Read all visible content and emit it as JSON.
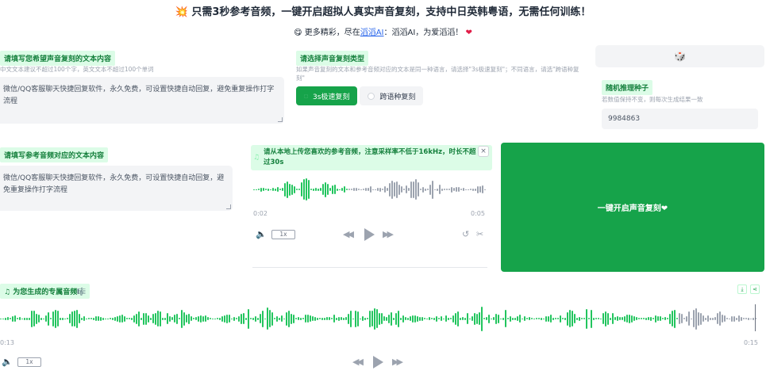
{
  "header": {
    "title": "💥 只需3秒参考音频，一键开启超拟人真实声音复刻，支持中日英韩粤语，无需任何训练！",
    "sub_prefix": "😋 更多精彩，尽在",
    "sub_link": "滔滔AI",
    "sub_suffix": "：滔滔AI，为爱滔滔！",
    "sub_heart": "❤"
  },
  "target_text": {
    "label": "请填写您希望声音复刻的文本内容",
    "hint": "中文文本建议不超过100个字，英文文本不超过100个单词",
    "value": "微信/QQ客服聊天快捷回复软件，永久免费，可设置快捷自动回复，避免重复操作打字流程"
  },
  "clone_type": {
    "label": "请选择声音复刻类型",
    "hint": "如果声音复刻的文本和参考音频对应的文本是同一种语言，请选择\"3s极速复刻\"；不同语言，请选\"跨语种复刻\"",
    "options": [
      "3s极速复刻",
      "跨语种复刻"
    ],
    "selected": "3s极速复刻"
  },
  "seed": {
    "dice_icon": "🎲",
    "label": "随机推理种子",
    "hint": "若数值保持不变，则每次生成结果一致",
    "value": "9984863"
  },
  "ref_text": {
    "label": "请填写参考音频对应的文本内容",
    "value": "微信/QQ客服聊天快捷回复软件，永久免费，可设置快捷自动回复，避免重复操作打字流程"
  },
  "ref_audio": {
    "note_icon": "♫",
    "banner": "请从本地上传您喜欢的参考音频，注意采样率不低于16kHz，时长不超过30s",
    "close": "×",
    "time_current": "0:02",
    "time_total": "0:05",
    "speed": "1x",
    "volume_icon": "🔈",
    "undo_icon": "↺",
    "cut_icon": "✂"
  },
  "generate": {
    "label": "一键开启声音复刻❤"
  },
  "output": {
    "label": "♫ 为您生成的专属音频🎼",
    "time_current": "0:13",
    "time_total": "0:15",
    "speed": "1x",
    "volume_icon": "🔈",
    "download_icon": "⤓",
    "share_icon": "⋖"
  },
  "colors": {
    "accent": "#16a34a",
    "chip_bg": "#dcfce7",
    "chip_text": "#15803d",
    "wave_played": "#22c55e",
    "wave_unplayed": "#9ca3af"
  }
}
